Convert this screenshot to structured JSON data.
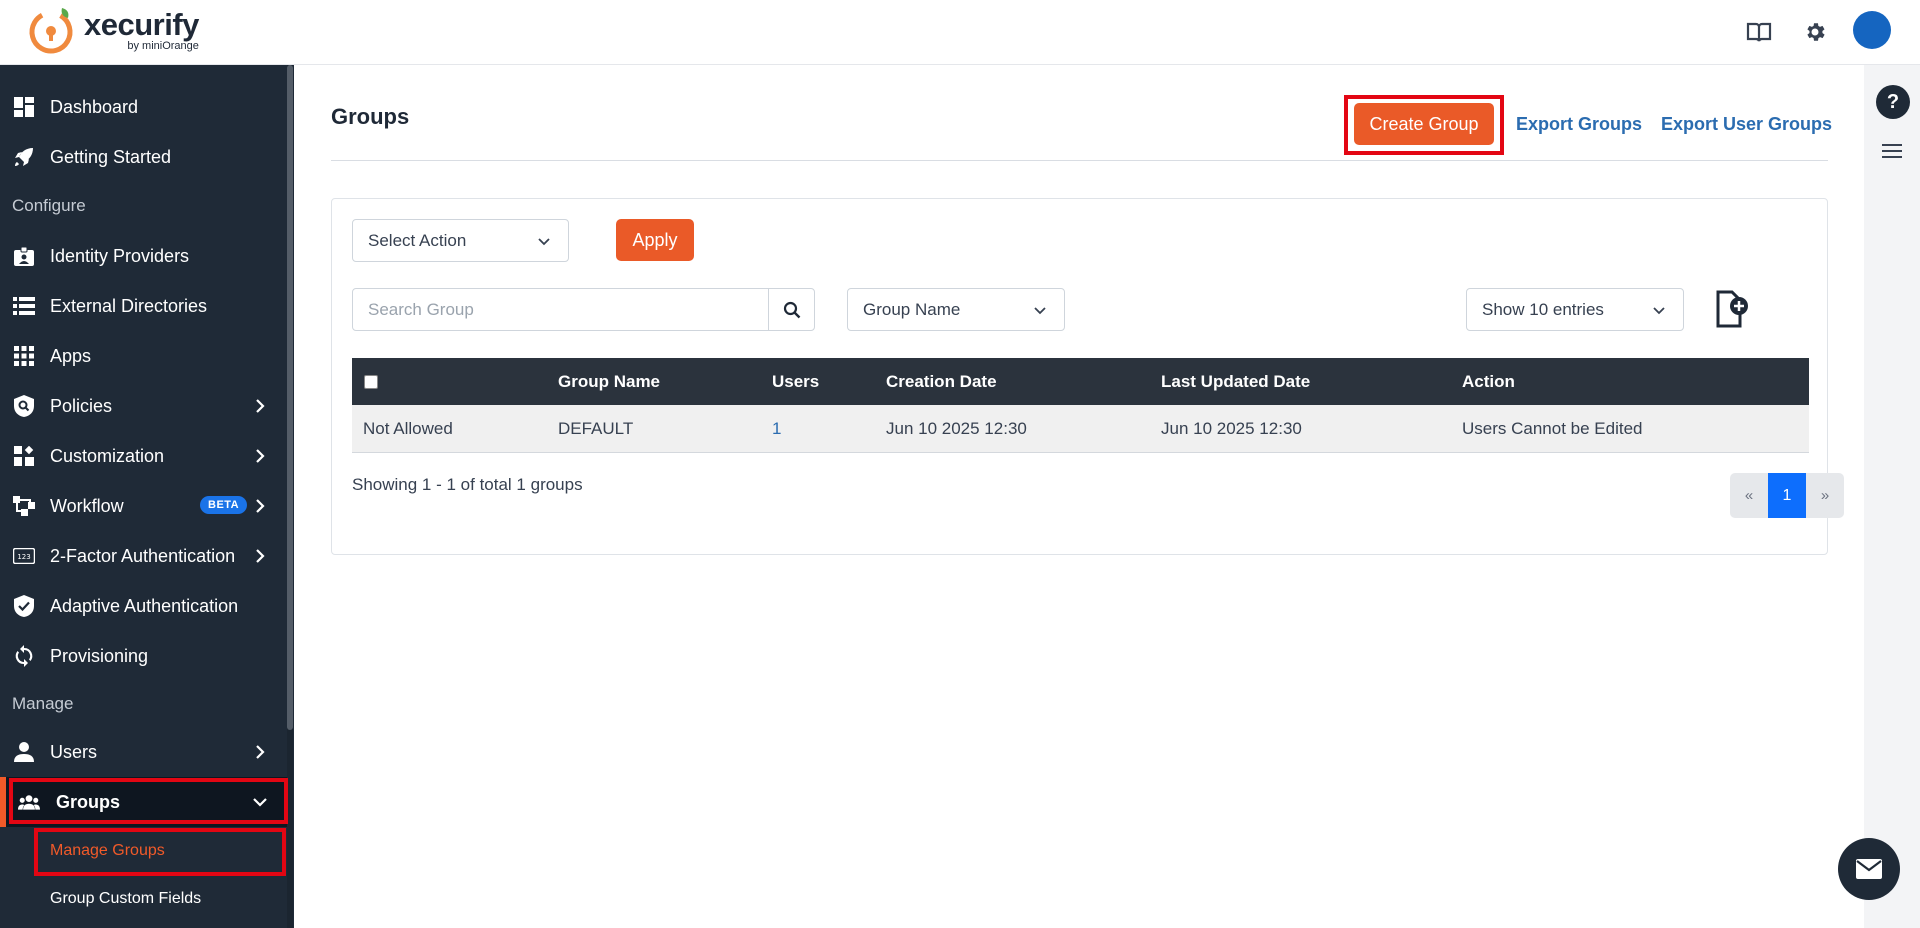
{
  "app": {
    "name": "xecurify",
    "by_text": "by miniOrange"
  },
  "header": {
    "icons": [
      "book-icon",
      "gear-icon",
      "avatar"
    ]
  },
  "sidebar": {
    "items": [
      {
        "label": "Dashboard",
        "icon": "dashboard-icon"
      },
      {
        "label": "Getting Started",
        "icon": "rocket-icon"
      },
      {
        "section": "Configure"
      },
      {
        "label": "Identity Providers",
        "icon": "id-badge-icon"
      },
      {
        "label": "External Directories",
        "icon": "list-icon"
      },
      {
        "label": "Apps",
        "icon": "grid-icon"
      },
      {
        "label": "Policies",
        "icon": "shield-search-icon"
      },
      {
        "label": "Customization",
        "icon": "widgets-icon"
      },
      {
        "label": "Workflow",
        "icon": "workflow-icon",
        "badge": "BETA"
      },
      {
        "label": "2-Factor Authentication",
        "icon": "123-icon"
      },
      {
        "label": "Adaptive Authentication",
        "icon": "shield-check-icon"
      },
      {
        "label": "Provisioning",
        "icon": "sync-icon"
      },
      {
        "section": "Manage"
      },
      {
        "label": "Users",
        "icon": "user-icon"
      },
      {
        "label": "Groups",
        "icon": "group-icon"
      }
    ],
    "subitems": [
      {
        "label": "Manage Groups"
      },
      {
        "label": "Group Custom Fields"
      }
    ]
  },
  "page": {
    "title": "Groups",
    "create_button": "Create Group",
    "export_groups": "Export Groups",
    "export_user_groups": "Export User Groups"
  },
  "toolbar": {
    "action_select": "Select Action",
    "apply": "Apply",
    "search_placeholder": "Search Group",
    "filter_select": "Group Name",
    "entries_select": "Show 10 entries"
  },
  "table": {
    "headers": [
      "",
      "Group Name",
      "Users",
      "Creation Date",
      "Last Updated Date",
      "Action"
    ],
    "rows": [
      [
        "Not Allowed",
        "DEFAULT",
        "1",
        "Jun 10 2025 12:30",
        "Jun 10 2025 12:30",
        "Users Cannot be Edited"
      ]
    ]
  },
  "footer": {
    "showing": "Showing 1 - 1 of total 1 groups",
    "pager": {
      "prev": "«",
      "current": "1",
      "next": "»"
    }
  },
  "right_rail": {
    "help": "?"
  },
  "colors": {
    "accent": "#ea5a28",
    "sidebar": "#1f2a37",
    "link": "#2b6cb0",
    "highlight": "#e30613",
    "pager_active": "#0d6efd"
  }
}
